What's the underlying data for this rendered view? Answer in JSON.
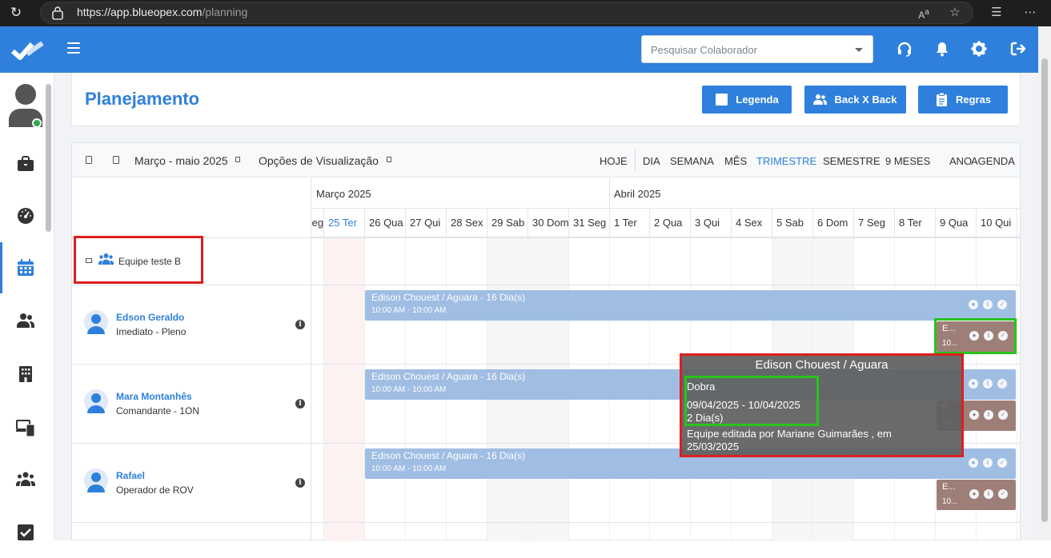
{
  "browser": {
    "url_host": "https://app.blueopex.com",
    "url_path": "/planning"
  },
  "header": {
    "search_placeholder": "Pesquisar Colaborador",
    "colors": {
      "primary": "#2f80dc"
    }
  },
  "sidebar": {
    "items": [
      {
        "icon": "briefcase-icon"
      },
      {
        "icon": "dashboard-icon"
      },
      {
        "icon": "calendar-icon",
        "active": true
      },
      {
        "icon": "users-icon"
      },
      {
        "icon": "building-icon"
      },
      {
        "icon": "devices-icon"
      },
      {
        "icon": "team-icon"
      },
      {
        "icon": "checkbox-icon"
      }
    ]
  },
  "page": {
    "title": "Planejamento",
    "buttons": {
      "legend": "Legenda",
      "backxback": "Back X Back",
      "rules": "Regras"
    }
  },
  "toolbar": {
    "period": "Março - maio 2025",
    "view_options": "Opções de Visualização",
    "views": [
      "HOJE",
      "DIA",
      "SEMANA",
      "MÊS",
      "TRIMESTRE",
      "SEMESTRE",
      "9 MESES",
      "ANO",
      "AGENDA"
    ],
    "active_view": "TRIMESTRE"
  },
  "calendar": {
    "months": [
      "Março 2025",
      "Abril 2025"
    ],
    "days": [
      {
        "label": "Seg",
        "weekend": false
      },
      {
        "label": "25  Ter",
        "weekend": false,
        "today": true
      },
      {
        "label": "26  Qua",
        "weekend": false
      },
      {
        "label": "27  Qui",
        "weekend": false
      },
      {
        "label": "28  Sex",
        "weekend": false
      },
      {
        "label": "29  Sab",
        "weekend": true
      },
      {
        "label": "30  Dom",
        "weekend": true
      },
      {
        "label": "31  Seg",
        "weekend": false
      },
      {
        "label": "1  Ter",
        "weekend": false
      },
      {
        "label": "2  Qua",
        "weekend": false
      },
      {
        "label": "3  Qui",
        "weekend": false
      },
      {
        "label": "4  Sex",
        "weekend": false
      },
      {
        "label": "5  Sab",
        "weekend": true
      },
      {
        "label": "6  Dom",
        "weekend": true
      },
      {
        "label": "7  Seg",
        "weekend": false
      },
      {
        "label": "8  Ter",
        "weekend": false
      },
      {
        "label": "9  Qua",
        "weekend": false
      },
      {
        "label": "10  Qui",
        "weekend": false
      }
    ]
  },
  "team": {
    "name": "Equipe teste B"
  },
  "people": [
    {
      "name": "Edson Geraldo",
      "role": "Imediato - Pleno"
    },
    {
      "name": "Mara Montanhês",
      "role": "Comandante - 1ON"
    },
    {
      "name": "Rafael",
      "role": "Operador de ROV"
    }
  ],
  "assignments": {
    "main_title": "Edison Chouest / Aguara - 16 Dia(s)",
    "main_time": "10:00 AM - 10:00 AM",
    "short_title": "E...",
    "short_time": "10..."
  },
  "tooltip": {
    "title": "Edison Chouest / Aguara",
    "type": "Dobra",
    "dates": "09/04/2025 - 10/04/2025",
    "duration": "2 Dia(s)",
    "edited_line1": "Equipe editada por Mariane Guimarães , em",
    "edited_line2": "25/03/2025"
  }
}
